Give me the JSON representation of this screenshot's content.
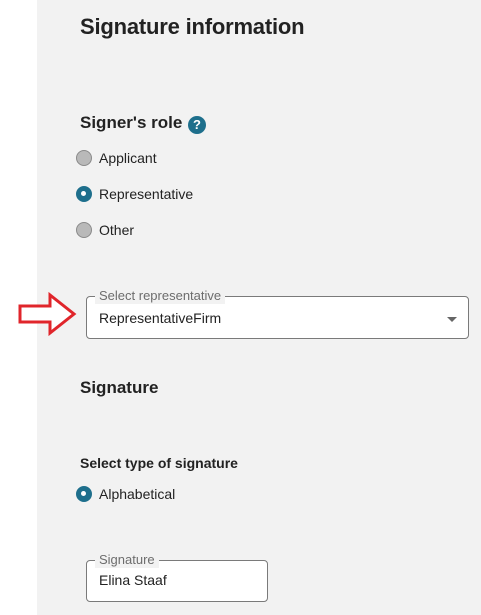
{
  "page": {
    "title": "Signature information",
    "signers_role": {
      "heading": "Signer's role",
      "help_icon": "?",
      "options": [
        "Applicant",
        "Representative",
        "Other"
      ],
      "selected": "Representative"
    },
    "representative_select": {
      "label": "Select representative",
      "value": "RepresentativeFirm"
    },
    "signature": {
      "heading": "Signature",
      "type_heading": "Select type of signature",
      "type_options": [
        "Alphabetical"
      ],
      "selected_type": "Alphabetical",
      "field_label": "Signature",
      "field_value": "Elina Staaf"
    }
  },
  "colors": {
    "accent": "#1e6f8c",
    "annotation_arrow": "#e0252b",
    "panel_bg": "#f2f2f2"
  },
  "icons": {
    "help": "question-circle-icon",
    "dropdown": "caret-down-icon",
    "annotation": "red-outline-arrow-icon"
  }
}
